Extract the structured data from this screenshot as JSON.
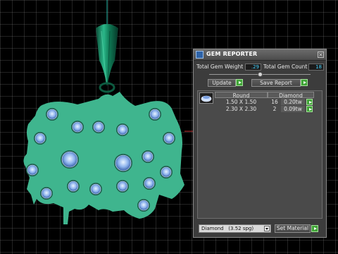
{
  "gem_reporter": {
    "title": "GEM REPORTER",
    "total_weight_label": "Total Gem Weight",
    "total_weight_value": ".29",
    "total_count_label": "Total Gem Count",
    "total_count_value": "18",
    "update_label": "Update",
    "save_report_label": "Save Report",
    "table": {
      "headers": [
        "Round",
        "Diamond"
      ],
      "rows": [
        {
          "size": "1.50 X 1.50",
          "count": "16",
          "weight": "0.20tw"
        },
        {
          "size": "2.30 X 2.30",
          "count": "2",
          "weight": "0.09tw"
        }
      ]
    },
    "material_name": "Diamond",
    "material_sg": "(3.52 spg)",
    "set_material_label": "Set Material"
  },
  "colors": {
    "pendant_fill": "#3fb58e",
    "gem_fill": "#6f9be0",
    "bail_fill": "#0f6b4c",
    "grid_line": "#b0b0b0",
    "accent_value": "#47d3ff"
  }
}
